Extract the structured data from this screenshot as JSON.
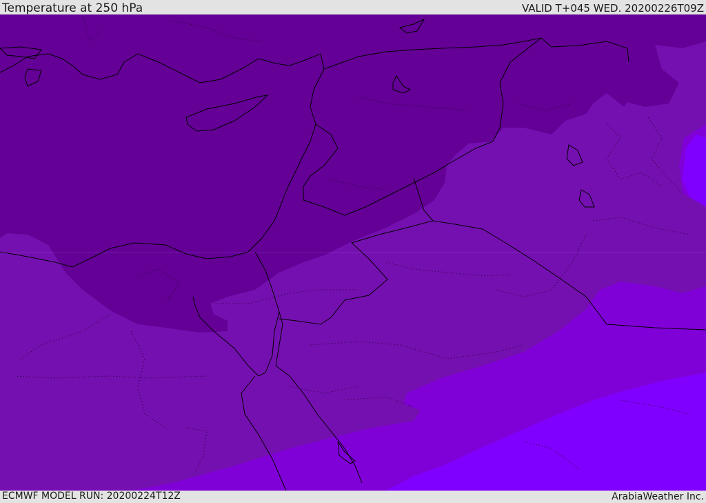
{
  "header": {
    "title": "Temperature at 250 hPa",
    "valid": "VALID T+045 WED. 20200226T09Z"
  },
  "footer": {
    "model_run": "ECMWF MODEL RUN: 20200224T12Z",
    "credit": "ArabiaWeather Inc."
  },
  "map": {
    "field": "temperature-250hPa",
    "colors": {
      "coldest": "#640096",
      "cold": "#7510b0",
      "mid": "#8000d8",
      "warm": "#8000ff",
      "border": "#000000"
    }
  }
}
